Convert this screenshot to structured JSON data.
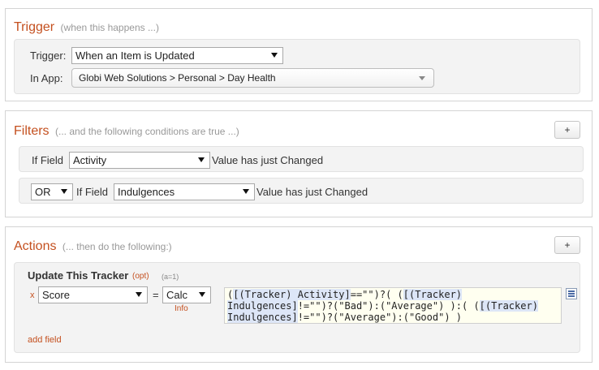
{
  "trigger": {
    "title": "Trigger",
    "subtitle": "(when this happens ...)",
    "trigger_label": "Trigger:",
    "trigger_value": "When an Item is Updated",
    "app_label": "In App:",
    "app_value": "Globi Web Solutions > Personal > Day Health"
  },
  "filters": {
    "title": "Filters",
    "subtitle": "(... and the following conditions are true ...)",
    "add_label": "+",
    "conditions": [
      {
        "connector": "",
        "field_label": "If Field",
        "field_value": "Activity",
        "condition_text": "Value has just Changed"
      },
      {
        "connector": "OR",
        "field_label": "If Field",
        "field_value": "Indulgences",
        "condition_text": "Value has just Changed"
      }
    ]
  },
  "actions": {
    "title": "Actions",
    "subtitle": "(... then do the following:)",
    "add_label": "+",
    "action": {
      "title": "Update This Tracker",
      "opt_label": "(opt)",
      "meta_label": "(a=1)",
      "remove_label": "x",
      "field_value": "Score",
      "equals": "=",
      "calc_value": "Calc",
      "info_label": "Info",
      "formula_lines": [
        {
          "pre": "(",
          "hl": "[(Tracker) Activity]",
          "post": "==\"\")?( ("
        },
        {
          "pre": "",
          "hl": "[(Tracker)",
          "post": ""
        },
        {
          "pre": "",
          "hl": "Indulgences]",
          "post": "!=\"\")?(\"Bad\"):(\"Average\") ):( ("
        },
        {
          "pre": "",
          "hl": "[(Tracker)",
          "post": ""
        },
        {
          "pre": "",
          "hl": "Indulgences]",
          "post": "!=\"\")?(\"Average\"):(\"Good\") )"
        }
      ],
      "add_field_label": "add field"
    }
  }
}
